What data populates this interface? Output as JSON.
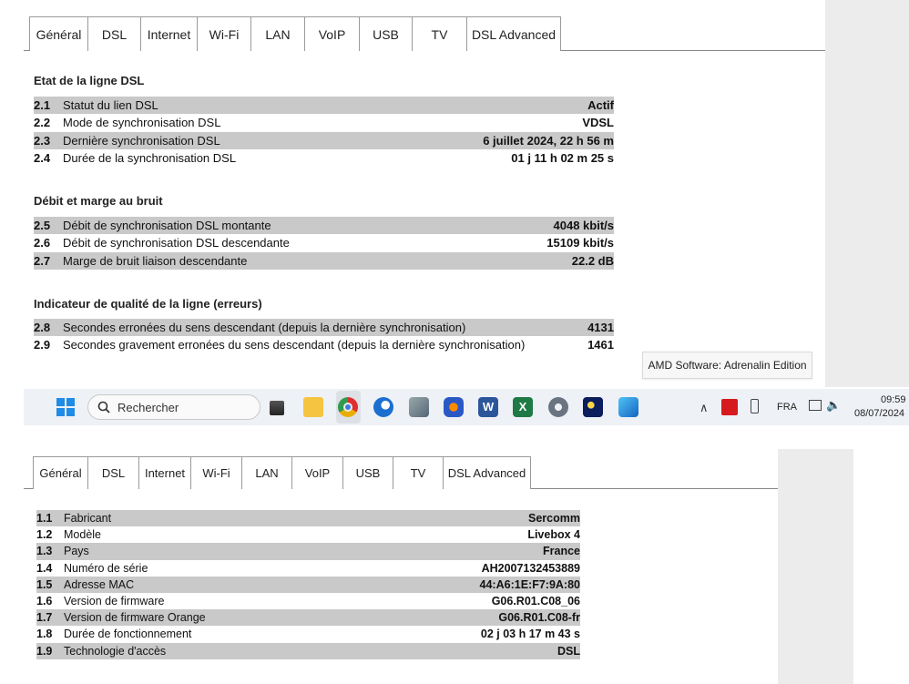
{
  "dsl_tabs": [
    "Général",
    "DSL",
    "Internet",
    "Wi-Fi",
    "LAN",
    "VoIP",
    "USB",
    "TV",
    "DSL Advanced"
  ],
  "dsl_active_tab": "DSL",
  "sections": [
    {
      "title": "Etat de la ligne DSL",
      "rows": [
        {
          "num": "2.1",
          "label": "Statut du lien DSL",
          "value": "Actif"
        },
        {
          "num": "2.2",
          "label": "Mode de synchronisation DSL",
          "value": "VDSL"
        },
        {
          "num": "2.3",
          "label": "Dernière synchronisation DSL",
          "value": "6 juillet 2024, 22 h 56 m"
        },
        {
          "num": "2.4",
          "label": "Durée de la synchronisation DSL",
          "value": "01 j 11 h 02 m 25 s"
        }
      ]
    },
    {
      "title": "Débit et marge au bruit",
      "rows": [
        {
          "num": "2.5",
          "label": "Débit de synchronisation DSL montante",
          "value": "4048 kbit/s"
        },
        {
          "num": "2.6",
          "label": "Débit de synchronisation DSL descendante",
          "value": "15109 kbit/s"
        },
        {
          "num": "2.7",
          "label": "Marge de bruit liaison descendante",
          "value": "22.2 dB"
        }
      ]
    },
    {
      "title": "Indicateur de qualité de la ligne (erreurs)",
      "rows": [
        {
          "num": "2.8",
          "label": "Secondes erronées du sens descendant (depuis la dernière synchronisation)",
          "value": "4131"
        },
        {
          "num": "2.9",
          "label": "Secondes gravement erronées du sens descendant (depuis la dernière synchronisation)",
          "value": "1461"
        }
      ]
    }
  ],
  "tooltip": "AMD Software: Adrenalin Edition",
  "taskbar": {
    "search_placeholder": "Rechercher",
    "language": "FRA",
    "time": "09:59",
    "date": "08/07/2024"
  },
  "general_tabs": [
    "Général",
    "DSL",
    "Internet",
    "Wi-Fi",
    "LAN",
    "VoIP",
    "USB",
    "TV",
    "DSL Advanced"
  ],
  "general_active_tab": "Général",
  "general_rows": [
    {
      "num": "1.1",
      "label": "Fabricant",
      "value": "Sercomm"
    },
    {
      "num": "1.2",
      "label": "Modèle",
      "value": "Livebox 4"
    },
    {
      "num": "1.3",
      "label": "Pays",
      "value": "France"
    },
    {
      "num": "1.4",
      "label": "Numéro de série",
      "value": "AH2007132453889"
    },
    {
      "num": "1.5",
      "label": "Adresse MAC",
      "value": "44:A6:1E:F7:9A:80"
    },
    {
      "num": "1.6",
      "label": "Version de firmware",
      "value": "G06.R01.C08_06"
    },
    {
      "num": "1.7",
      "label": "Version de firmware Orange",
      "value": "G06.R01.C08-fr"
    },
    {
      "num": "1.8",
      "label": "Durée de fonctionnement",
      "value": "02 j 03 h 17 m 43 s"
    },
    {
      "num": "1.9",
      "label": "Technologie d'accès",
      "value": "DSL"
    }
  ]
}
